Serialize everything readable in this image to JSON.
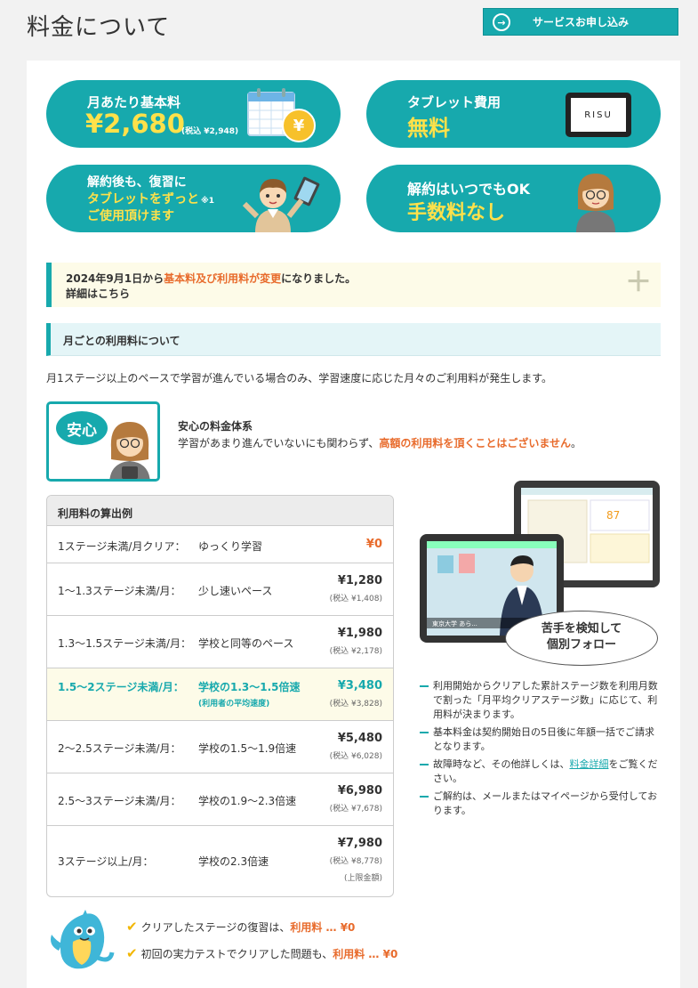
{
  "page": {
    "title": "料金について",
    "apply_button": "サービスお申し込み"
  },
  "pills": {
    "monthly_label": "月あたり基本料",
    "monthly_price": "¥2,680",
    "monthly_tax": "(税込 ¥2,948)",
    "yen_badge": "¥",
    "tablet_label": "タブレット費用",
    "tablet_value": "無料",
    "tablet_brand": "RISU",
    "after_line1": "解約後も、復習に",
    "after_line2": "タブレットをずっと",
    "after_note": "※1",
    "after_line3": "ご使用頂けます",
    "cancel_line1": "解約はいつでもOK",
    "cancel_line2": "手数料なし"
  },
  "notice": {
    "date_prefix": "2024年9月1日から",
    "highlight": "基本料及び利用料が変更",
    "suffix": "になりました。",
    "line2": "詳細はこちら",
    "plus": "＋"
  },
  "section": {
    "heading": "月ごとの利用料について",
    "intro": "月1ステージ以上のペースで学習が進んでいる場合のみ、学習速度に応じた月々のご利用料が発生します。"
  },
  "anshin": {
    "badge": "安心",
    "title": "安心の料金体系",
    "text_prefix": "学習があまり進んでいないにも関わらず、",
    "text_highlight": "高額の利用料を頂くことはございません",
    "text_suffix": "。"
  },
  "calc": {
    "heading": "利用料の算出例",
    "rows": [
      {
        "stage": "1ステージ未満/月クリア：",
        "pace": "ゆっくり学習",
        "price": "¥0",
        "tax": "",
        "sub": "",
        "extra": ""
      },
      {
        "stage": "1〜1.3ステージ未満/月：",
        "pace": "少し速いペース",
        "price": "¥1,280",
        "tax": "(税込 ¥1,408)",
        "sub": "",
        "extra": ""
      },
      {
        "stage": "1.3〜1.5ステージ未満/月：",
        "pace": "学校と同等のペース",
        "price": "¥1,980",
        "tax": "(税込 ¥2,178)",
        "sub": "",
        "extra": ""
      },
      {
        "stage": "1.5〜2ステージ未満/月：",
        "pace": "学校の1.3〜1.5倍速",
        "price": "¥3,480",
        "tax": "(税込 ¥3,828)",
        "sub": "(利用者の平均速度)",
        "extra": ""
      },
      {
        "stage": "2〜2.5ステージ未満/月：",
        "pace": "学校の1.5〜1.9倍速",
        "price": "¥5,480",
        "tax": "(税込 ¥6,028)",
        "sub": "",
        "extra": ""
      },
      {
        "stage": "2.5〜3ステージ未満/月：",
        "pace": "学校の1.9〜2.3倍速",
        "price": "¥6,980",
        "tax": "(税込 ¥7,678)",
        "sub": "",
        "extra": ""
      },
      {
        "stage": "3ステージ以上/月：",
        "pace": "学校の2.3倍速",
        "price": "¥7,980",
        "tax": "(税込 ¥8,778)",
        "sub": "",
        "extra": "(上限金額)"
      }
    ]
  },
  "tablet_screen": {
    "score": "87",
    "caption": "東京大学 あら..."
  },
  "bubble": {
    "line1": "苦手を検知して",
    "line2": "個別フォロー"
  },
  "notes": {
    "n1": "利用開始からクリアした累計ステージ数を利用月数で割った「月平均クリアステージ数」に応じて、利用料が決まります。",
    "n2": "基本料金は契約開始日の5日後に年額一括でご請求となります。",
    "n3_prefix": "故障時など、その他詳しくは、",
    "n3_link": "料金詳細",
    "n3_suffix": "をご覧ください。",
    "n4": "ご解約は、メールまたはマイページから受付しております。"
  },
  "bottom": {
    "l1_text": "クリアしたステージの復習は、",
    "l1_fee": "利用料 … ¥0",
    "l2_text": "初回の実力テストでクリアした問題も、",
    "l2_fee": "利用料 … ¥0"
  },
  "colors": {
    "accent": "#17a9ad",
    "highlight": "#e86b2c",
    "yellow": "#ffe14a"
  }
}
